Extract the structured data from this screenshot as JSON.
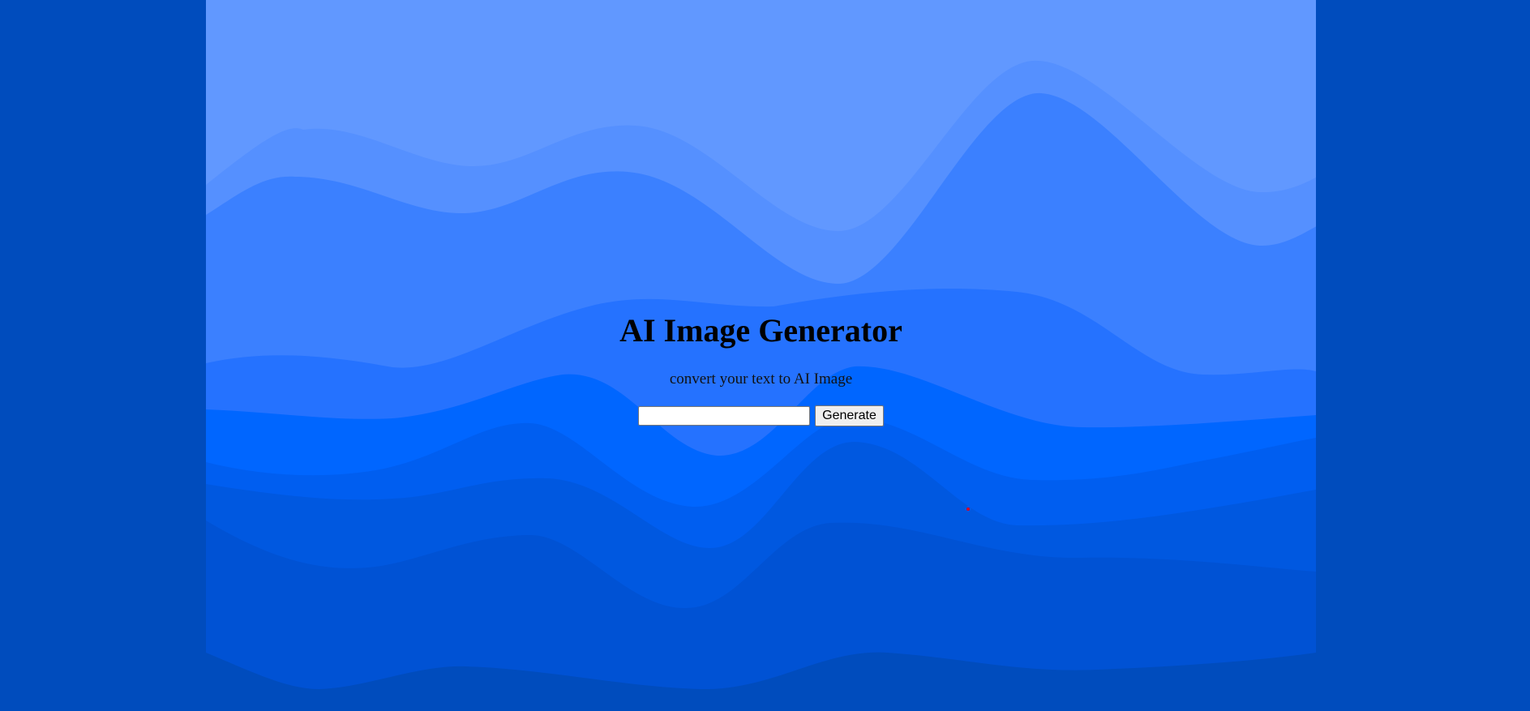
{
  "page": {
    "title": "AI Image Generator",
    "subtitle": "convert your text to AI Image"
  },
  "form": {
    "input_value": "",
    "input_placeholder": "",
    "generate_label": "Generate"
  },
  "colors": {
    "outer_background": "#004cbd",
    "wave_layers": [
      "#6198ff",
      "#5590ff",
      "#3b80ff",
      "#2572ff",
      "#0066ff",
      "#005ef0",
      "#0058e0",
      "#0052d4",
      "#004cbd"
    ],
    "marker": "#d6002a"
  }
}
